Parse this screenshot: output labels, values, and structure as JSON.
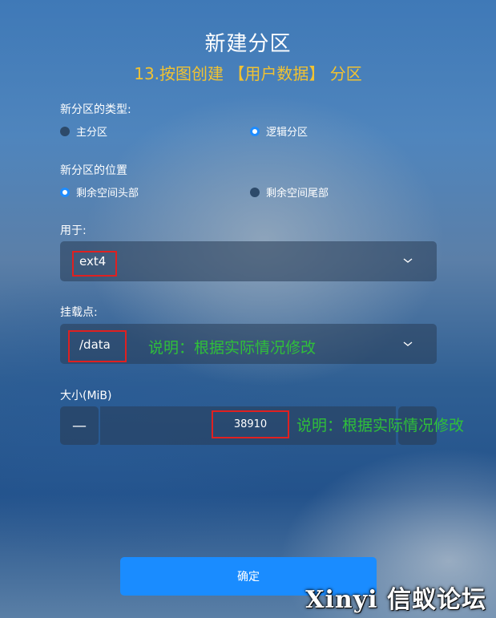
{
  "dialog": {
    "title": "新建分区",
    "subtitle": "13.按图创建 【用户数据】 分区"
  },
  "partition_type": {
    "label": "新分区的类型:",
    "options": [
      {
        "label": "主分区",
        "selected": false
      },
      {
        "label": "逻辑分区",
        "selected": true
      }
    ]
  },
  "partition_location": {
    "label": "新分区的位置",
    "options": [
      {
        "label": "剩余空间头部",
        "selected": true
      },
      {
        "label": "剩余空间尾部",
        "selected": false
      }
    ]
  },
  "usage": {
    "label": "用于:",
    "value": "ext4"
  },
  "mount_point": {
    "label": "挂载点:",
    "value": "/data",
    "annotation": "说明：根据实际情况修改"
  },
  "size": {
    "label": "大小(MiB)",
    "value": "38910",
    "decrement": "—",
    "annotation": "说明：根据实际情况修改"
  },
  "confirm_label": "确定",
  "watermark": "Xinyi 信蚁论坛",
  "colors": {
    "accent": "#1a8cff",
    "subtitle": "#f1c232",
    "annotation": "#2fbf3a",
    "highlight_box": "#e02020"
  }
}
